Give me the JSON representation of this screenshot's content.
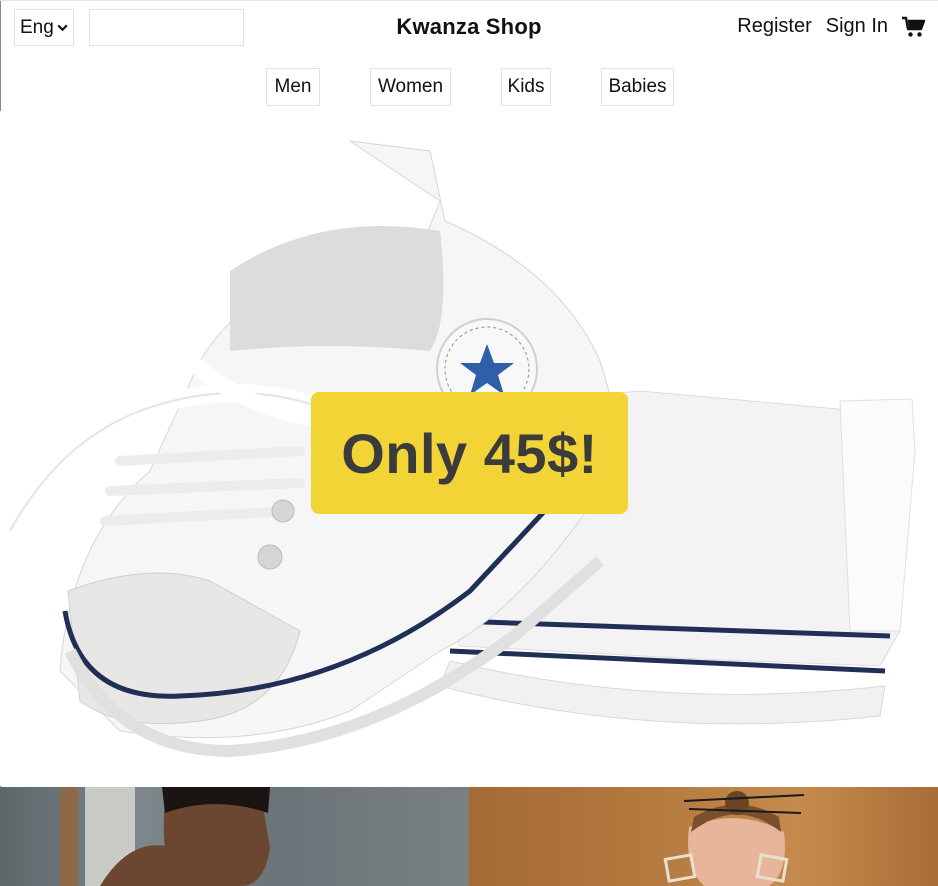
{
  "header": {
    "language": "Eng",
    "search": {
      "value": "",
      "placeholder": ""
    },
    "brand": "Kwanza Shop",
    "register": "Register",
    "sign_in": "Sign In",
    "cart_icon": "shopping-cart-icon"
  },
  "nav": {
    "items": [
      {
        "label": "Men"
      },
      {
        "label": "Women"
      },
      {
        "label": "Kids"
      },
      {
        "label": "Babies"
      }
    ]
  },
  "hero": {
    "promo_text": "Only 45$!",
    "image": "white-baby-sneakers",
    "promo_color": "#f2d437",
    "promo_text_color": "#3b3b3b"
  },
  "tiles": [
    {
      "image": "man-portrait"
    },
    {
      "image": "woman-portrait-earrings"
    }
  ]
}
